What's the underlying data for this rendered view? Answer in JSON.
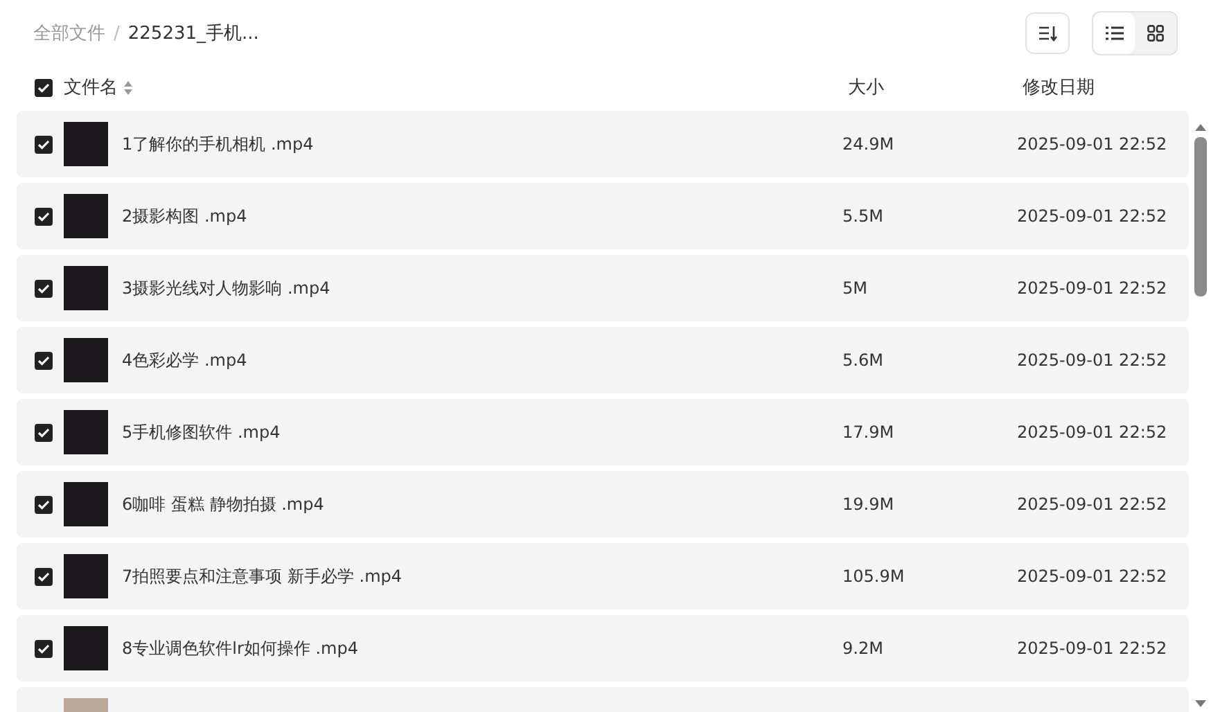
{
  "breadcrumb": {
    "root": "全部文件",
    "separator": "/",
    "current": "225231_手机..."
  },
  "view_modes": [
    {
      "kind": "list",
      "selected": true
    },
    {
      "kind": "grid",
      "selected": false
    }
  ],
  "header": {
    "all_checked": true,
    "name": "文件名",
    "size": "大小",
    "date": "修改日期"
  },
  "files": [
    {
      "name": "1了解你的手机相机 .mp4",
      "size": "24.9M",
      "date": "2025-09-01 22:52",
      "checked": true
    },
    {
      "name": "2摄影构图 .mp4",
      "size": "5.5M",
      "date": "2025-09-01 22:52",
      "checked": true
    },
    {
      "name": "3摄影光线对人物影响 .mp4",
      "size": "5M",
      "date": "2025-09-01 22:52",
      "checked": true
    },
    {
      "name": "4色彩必学 .mp4",
      "size": "5.6M",
      "date": "2025-09-01 22:52",
      "checked": true
    },
    {
      "name": "5手机修图软件 .mp4",
      "size": "17.9M",
      "date": "2025-09-01 22:52",
      "checked": true
    },
    {
      "name": "6咖啡 蛋糕 静物拍摄 .mp4",
      "size": "19.9M",
      "date": "2025-09-01 22:52",
      "checked": true
    },
    {
      "name": "7拍照要点和注意事项 新手必学 .mp4",
      "size": "105.9M",
      "date": "2025-09-01 22:52",
      "checked": true
    },
    {
      "name": "8专业调色软件lr如何操作 .mp4",
      "size": "9.2M",
      "date": "2025-09-01 22:52",
      "checked": true
    }
  ]
}
